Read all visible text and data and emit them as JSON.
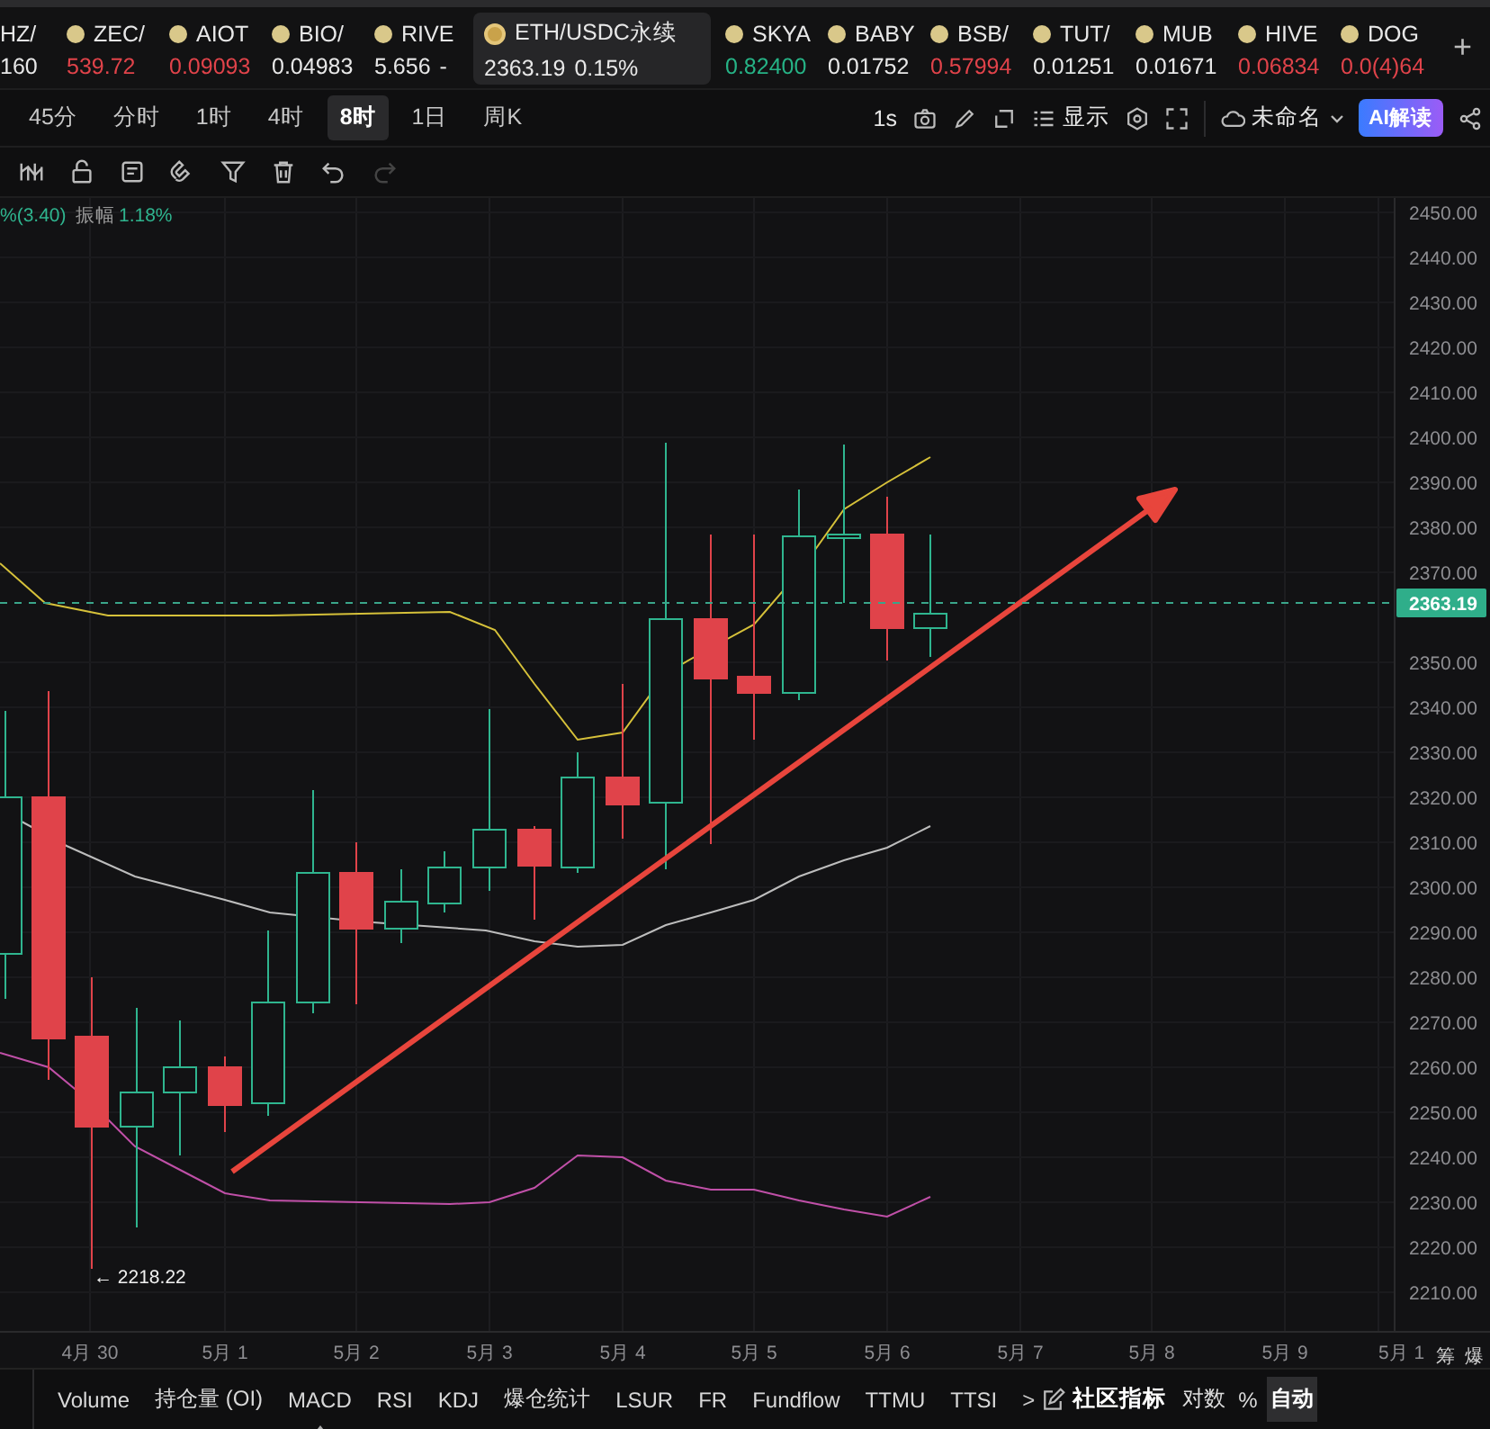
{
  "ticker": {
    "items": [
      {
        "kind": "cut",
        "symbol": "HZ/",
        "price": "160",
        "color": "#e8e8e8",
        "selected": false
      },
      {
        "kind": "coin",
        "symbol": "ZEC/",
        "price": "539.72",
        "color": "#e0434a",
        "selected": false
      },
      {
        "kind": "coin",
        "symbol": "AIOT",
        "price": "0.09093",
        "color": "#e0434a",
        "selected": false
      },
      {
        "kind": "coin",
        "symbol": "BIO/",
        "price": "0.04983",
        "color": "#e8e8e8",
        "selected": false
      },
      {
        "kind": "coin",
        "symbol": "RIVE",
        "price": "5.656",
        "change": "-",
        "color": "#e8e8e8",
        "selected": false
      },
      {
        "kind": "coin",
        "symbol": "ETH/USDC永续",
        "price": "2363.19",
        "change": "0.15%",
        "color": "#e8e8e8",
        "selected": true
      },
      {
        "kind": "coin",
        "symbol": "SKYA",
        "price": "0.82400",
        "color": "#26b386",
        "selected": false
      },
      {
        "kind": "coin",
        "symbol": "BABY",
        "price": "0.01752",
        "color": "#e8e8e8",
        "selected": false
      },
      {
        "kind": "coin",
        "symbol": "BSB/",
        "price": "0.57994",
        "color": "#e0434a",
        "selected": false
      },
      {
        "kind": "coin",
        "symbol": "TUT/",
        "price": "0.01251",
        "color": "#e8e8e8",
        "selected": false
      },
      {
        "kind": "coin",
        "symbol": "MUB",
        "price": "0.01671",
        "color": "#e8e8e8",
        "selected": false
      },
      {
        "kind": "coin",
        "symbol": "HIVE",
        "price": "0.06834",
        "color": "#e0434a",
        "selected": false
      },
      {
        "kind": "coin",
        "symbol": "DOG",
        "price": "0.0(4)64",
        "color": "#e0434a",
        "selected": false
      }
    ],
    "add": "+"
  },
  "intervals": [
    {
      "label": "45分",
      "selected": false
    },
    {
      "label": "分时",
      "selected": false
    },
    {
      "label": "1时",
      "selected": false
    },
    {
      "label": "4时",
      "selected": false
    },
    {
      "label": "8时",
      "selected": true
    },
    {
      "label": "1日",
      "selected": false
    },
    {
      "label": "周K",
      "selected": false
    }
  ],
  "toolbar": {
    "refresh": "1s",
    "display": "显示",
    "layout_name": "未命名",
    "ai": "AI解读"
  },
  "chart": {
    "change": "%(3.40)",
    "amplitude_label": "振幅",
    "amplitude": "1.18%",
    "price_ticks": [
      "2450.00",
      "2440.00",
      "2430.00",
      "2420.00",
      "2410.00",
      "2400.00",
      "2390.00",
      "2380.00",
      "2370.00",
      "2350.00",
      "2340.00",
      "2330.00",
      "2320.00",
      "2310.00",
      "2300.00",
      "2290.00",
      "2280.00",
      "2270.00",
      "2260.00",
      "2250.00",
      "2240.00",
      "2230.00",
      "2220.00",
      "2210.00"
    ],
    "current_price": "2363.19",
    "low_marker": "← 2218.22",
    "dates": [
      "4月 30",
      "5月 1",
      "5月 2",
      "5月 3",
      "5月 4",
      "5月 5",
      "5月 6",
      "5月 7",
      "5月 8",
      "5月 9",
      "5月 1"
    ],
    "side_labels": [
      "筹",
      "爆"
    ]
  },
  "indicators": {
    "tabs": [
      "Volume",
      "持仓量 (OI)",
      "MACD",
      "RSI",
      "KDJ",
      "爆仓统计",
      "LSUR",
      "FR",
      "Fundflow",
      "TTMU",
      "TTSI"
    ],
    "more": ">",
    "community": "社区指标",
    "options": [
      {
        "label": "对数",
        "selected": false
      },
      {
        "label": "%",
        "selected": false
      },
      {
        "label": "自动",
        "selected": true
      }
    ]
  }
}
